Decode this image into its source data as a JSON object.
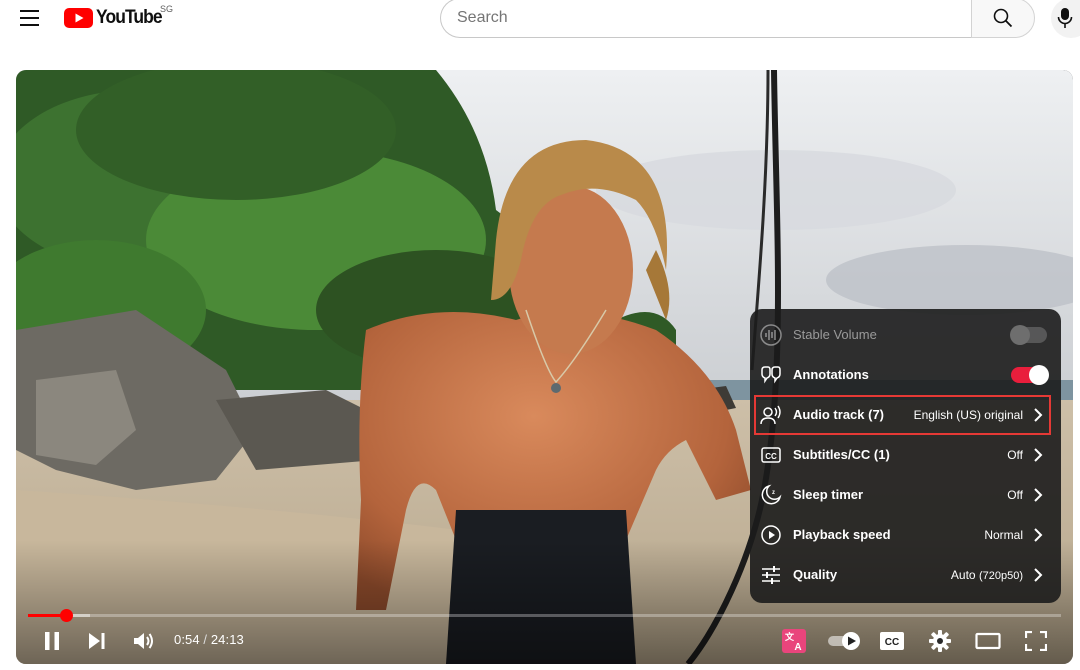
{
  "header": {
    "logo_text": "YouTube",
    "country_code": "SG",
    "search_placeholder": "Search"
  },
  "player": {
    "progress_fraction": 0.037,
    "buffered_fraction": 0.06,
    "time_current": "0:54",
    "time_separator": " / ",
    "time_duration": "24:13",
    "autoplay_on": true
  },
  "settings_menu": {
    "items": [
      {
        "label": "Stable Volume",
        "type": "toggle",
        "state": "off",
        "disabled": true,
        "icon": "stable-volume-icon"
      },
      {
        "label": "Annotations",
        "type": "toggle",
        "state": "on",
        "disabled": false,
        "icon": "annotations-icon"
      },
      {
        "label": "Audio track (7)",
        "type": "submenu",
        "value": "English (US) original",
        "highlighted": true,
        "icon": "audio-track-icon"
      },
      {
        "label": "Subtitles/CC (1)",
        "type": "submenu",
        "value": "Off",
        "icon": "subtitles-icon"
      },
      {
        "label": "Sleep timer",
        "type": "submenu",
        "value": "Off",
        "icon": "sleep-timer-icon"
      },
      {
        "label": "Playback speed",
        "type": "submenu",
        "value": "Normal",
        "icon": "playback-speed-icon"
      },
      {
        "label": "Quality",
        "type": "submenu",
        "value_main": "Auto",
        "value_detail": "(720p50)",
        "icon": "quality-icon"
      }
    ]
  },
  "colors": {
    "brand_red": "#ff0000",
    "toggle_on": "#e91e3c",
    "highlight_outline": "#e53935",
    "translate_badge": "#e9457c"
  }
}
